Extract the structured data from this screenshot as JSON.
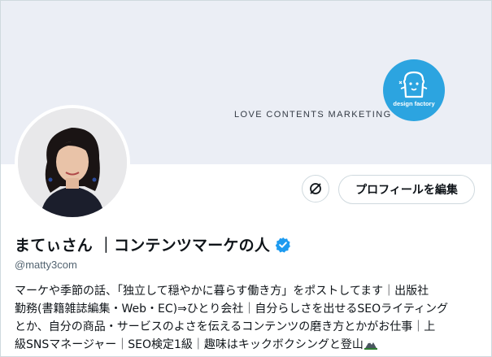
{
  "banner": {
    "tagline": "LOVE CONTENTS MARKETING",
    "logo_text": "design factory"
  },
  "profile": {
    "avatar": "avatar",
    "name": "まてぃさん ｜コンテンツマーケの人",
    "verified_icon": "verified-badge-icon",
    "handle": "@matty3com",
    "bio_lines": [
      "マーケや季節の話、「独立して穏やかに暮らす働き方」をポストしてます｜出版社",
      "勤務(書籍雑誌編集・Web・EC)⇒ひとり会社｜自分らしさを出せるSEOライティング",
      "とか、自分の商品・サービスのよさを伝えるコンテンツの磨き方とかがお仕事｜上",
      "級SNSマネージャー｜SEO検定1級｜趣味はキックボクシングと登山"
    ],
    "bio_end_icon": "mountain-icon"
  },
  "actions": {
    "more_icon": "no-notifications-icon",
    "edit_label": "プロフィールを編集"
  },
  "colors": {
    "banner_bg": "#ebeef5",
    "logo_bg": "#2ca4e0",
    "verified": "#1d9bf0",
    "text": "#0f1419",
    "muted": "#536471"
  }
}
